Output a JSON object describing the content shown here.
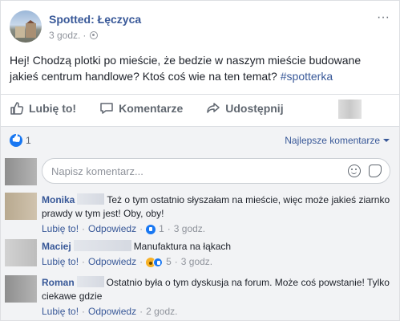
{
  "post": {
    "page_name": "Spotted: Łęczyca",
    "time": "3 godz.",
    "more_icon": "ellipsis-icon",
    "text": "Hej! Chodzą plotki po mieście, że bedzie w naszym mieście budowane jakieś centrum handlowe? Ktoś coś wie na ten temat? ",
    "hashtag": "#spotterka"
  },
  "actions": {
    "like": "Lubię to!",
    "comment": "Komentarze",
    "share": "Udostępnij"
  },
  "reactions": {
    "count": "1",
    "sort_label": "Najlepsze komentarze"
  },
  "comment_input": {
    "placeholder": "Napisz komentarz..."
  },
  "comments": [
    {
      "name": "Monika",
      "text": "Też o tym ostatnio słyszałam na mieście, więc może jakieś ziarnko prawdy w tym jest! Oby, oby!",
      "like": "Lubię to!",
      "reply": "Odpowiedz",
      "reaction_count": "1",
      "time": "3 godz."
    },
    {
      "name": "Maciej",
      "text": "Manufaktura na łąkach",
      "like": "Lubię to!",
      "reply": "Odpowiedz",
      "reaction_count": "5",
      "time": "3 godz."
    },
    {
      "name": "Roman",
      "text": "Ostatnio była o tym dyskusja na forum. Może coś powstanie! Tylko ciekawe gdzie",
      "like": "Lubię to!",
      "reply": "Odpowiedz",
      "time": "2 godz."
    }
  ],
  "separator": "·",
  "colors": {
    "link": "#385898",
    "meta": "#90949c",
    "background": "#f2f3f5"
  }
}
